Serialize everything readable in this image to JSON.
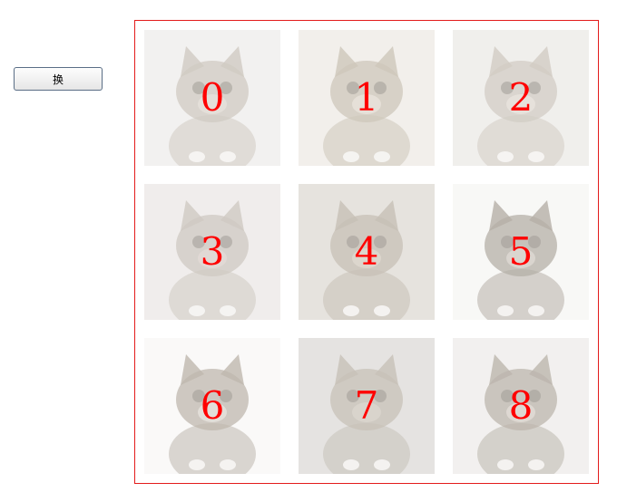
{
  "toolbar": {
    "swap_label": "换"
  },
  "tiles": [
    {
      "number": "0",
      "bg": "#eceae8",
      "fur": "#b8afa3",
      "tone": "#d7cfc6"
    },
    {
      "number": "1",
      "bg": "#ebe7e1",
      "fur": "#b4a996",
      "tone": "#dcd3c7"
    },
    {
      "number": "2",
      "bg": "#e9e6e2",
      "fur": "#bab1a5",
      "tone": "#dad3ca"
    },
    {
      "number": "3",
      "bg": "#e8e4e2",
      "fur": "#b6ada2",
      "tone": "#d3c7c0"
    },
    {
      "number": "4",
      "bg": "#d9d4cc",
      "fur": "#a99f90",
      "tone": "#ccc2b4"
    },
    {
      "number": "5",
      "bg": "#f5f4f2",
      "fur": "#8e8578",
      "tone": "#c9c2b8"
    },
    {
      "number": "6",
      "bg": "#f7f6f5",
      "fur": "#9d9283",
      "tone": "#d6d0c8"
    },
    {
      "number": "7",
      "bg": "#d8d5d2",
      "fur": "#aaa092",
      "tone": "#c7bfb3"
    },
    {
      "number": "8",
      "bg": "#ece9e6",
      "fur": "#998f82",
      "tone": "#d0c8be"
    }
  ]
}
